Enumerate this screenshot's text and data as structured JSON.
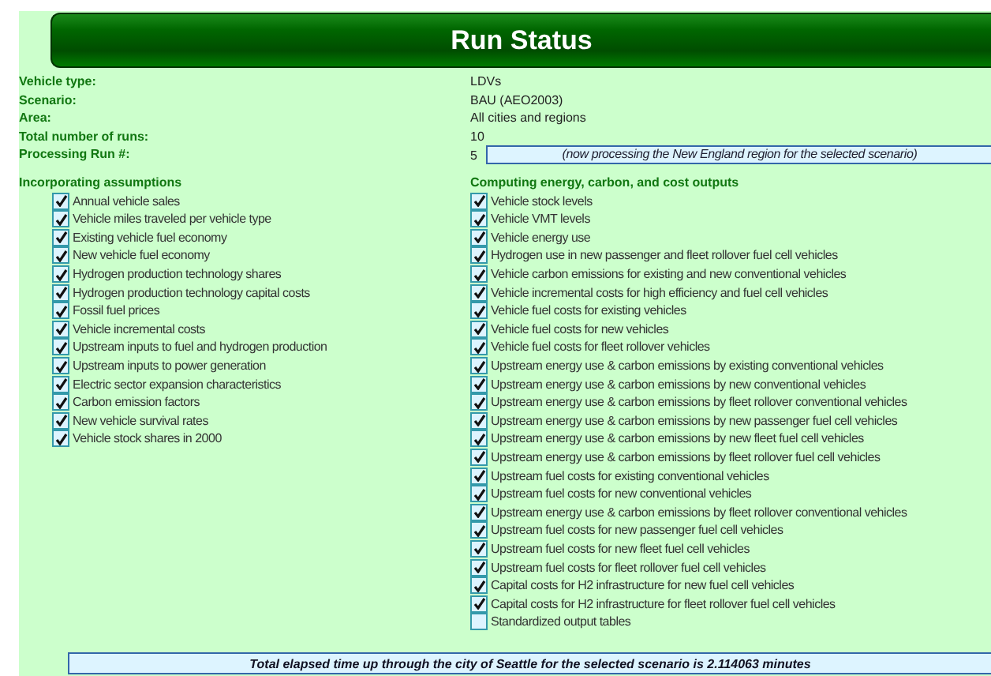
{
  "title": "Run Status",
  "info": [
    {
      "label": "Vehicle type:",
      "value": "LDVs"
    },
    {
      "label": "Scenario:",
      "value": "BAU (AEO2003)"
    },
    {
      "label": "Area:",
      "value": "All cities and regions"
    },
    {
      "label": "Total number of runs:",
      "value": "10"
    },
    {
      "label": "Processing Run #:",
      "value": "5",
      "note": "(now processing the New England region for the selected scenario)"
    }
  ],
  "assumptions": {
    "heading": "Incorporating assumptions",
    "items": [
      {
        "label": "Annual vehicle sales",
        "checked": true
      },
      {
        "label": "Vehicle miles traveled per vehicle type",
        "checked": true
      },
      {
        "label": "Existing vehicle fuel economy",
        "checked": true
      },
      {
        "label": "New vehicle fuel economy",
        "checked": true
      },
      {
        "label": "Hydrogen production technology shares",
        "checked": true
      },
      {
        "label": "Hydrogen production technology capital costs",
        "checked": true
      },
      {
        "label": "Fossil fuel prices",
        "checked": true
      },
      {
        "label": "Vehicle incremental costs",
        "checked": true
      },
      {
        "label": "Upstream inputs to fuel and hydrogen production",
        "checked": true
      },
      {
        "label": "Upstream inputs to power generation",
        "checked": true
      },
      {
        "label": "Electric sector expansion characteristics",
        "checked": true
      },
      {
        "label": "Carbon emission factors",
        "checked": true
      },
      {
        "label": "New vehicle survival rates",
        "checked": true
      },
      {
        "label": "Vehicle stock shares in 2000",
        "checked": true
      }
    ]
  },
  "outputs": {
    "heading": "Computing energy, carbon, and cost outputs",
    "items": [
      {
        "label": "Vehicle stock levels",
        "checked": true
      },
      {
        "label": "Vehicle VMT levels",
        "checked": true
      },
      {
        "label": "Vehicle energy use",
        "checked": true
      },
      {
        "label": "Hydrogen use in new passenger and fleet rollover fuel cell vehicles",
        "checked": true
      },
      {
        "label": "Vehicle carbon emissions for existing and new conventional vehicles",
        "checked": true
      },
      {
        "label": "Vehicle incremental costs for high efficiency and fuel cell vehicles",
        "checked": true
      },
      {
        "label": "Vehicle fuel costs for existing vehicles",
        "checked": true
      },
      {
        "label": "Vehicle fuel costs for new vehicles",
        "checked": true
      },
      {
        "label": "Vehicle fuel costs for fleet rollover vehicles",
        "checked": true
      },
      {
        "label": "Upstream energy use & carbon emissions by existing conventional vehicles",
        "checked": true
      },
      {
        "label": "Upstream energy use & carbon emissions by new conventional vehicles",
        "checked": true
      },
      {
        "label": "Upstream energy use & carbon emissions by fleet rollover conventional vehicles",
        "checked": true
      },
      {
        "label": "Upstream energy use & carbon emissions by new passenger fuel cell vehicles",
        "checked": true
      },
      {
        "label": "Upstream energy use & carbon emissions by new fleet fuel cell vehicles",
        "checked": true
      },
      {
        "label": "Upstream energy use & carbon emissions by fleet rollover fuel cell vehicles",
        "checked": true
      },
      {
        "label": "Upstream fuel costs for existing conventional vehicles",
        "checked": true
      },
      {
        "label": "Upstream fuel costs for new conventional vehicles",
        "checked": true
      },
      {
        "label": "Upstream energy use & carbon emissions by fleet rollover conventional vehicles",
        "checked": true
      },
      {
        "label": "Upstream fuel costs for new passenger fuel cell vehicles",
        "checked": true
      },
      {
        "label": "Upstream fuel costs for new fleet fuel cell vehicles",
        "checked": true
      },
      {
        "label": "Upstream fuel costs for fleet rollover fuel cell vehicles",
        "checked": true
      },
      {
        "label": "Capital costs for H2 infrastructure for new fuel cell vehicles",
        "checked": true
      },
      {
        "label": "Capital costs for H2 infrastructure for fleet rollover fuel cell vehicles",
        "checked": true
      },
      {
        "label": "Standardized output tables",
        "checked": false
      }
    ]
  },
  "footer": "Total elapsed time up through the city of Seattle for the selected scenario is 2.114063 minutes"
}
